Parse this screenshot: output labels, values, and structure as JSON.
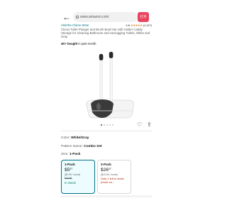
{
  "browser": {
    "back_glyph": "←",
    "url": "www.amazon.com",
    "open_app_label": "打开"
  },
  "product": {
    "store_link": "Visit the Clorox Store",
    "rating_value": "4.6",
    "rating_stars": "★★★★★",
    "rating_count": "(1,117)",
    "title": "Clorox Toilet Plunger and Brush Bowl Set with Holder Caddy Storage for Cleaning Bathroom and Unclogging Toilets, White and Gray",
    "bought_strong": "4K+ bought",
    "bought_rest": " in past month",
    "image_dots_total": 5,
    "image_dot_active": 1
  },
  "options": {
    "color_label": "Color: ",
    "color_value": "White/Gray",
    "pattern_label": "Pattern Name: ",
    "pattern_value": "Combo Set",
    "size_label": "Size: ",
    "size_value": "1-Pack",
    "sizes": [
      {
        "name": "1-Pack",
        "price_whole": "$5",
        "price_frac": "97",
        "unit": "($2.99 / count)",
        "list_price": "$19.99",
        "stock": "In Stock",
        "selected": true
      },
      {
        "name": "2-Pack",
        "price_whole": "$26",
        "price_frac": "07",
        "unit": "($13.04 / count)",
        "stock": "Only 1 left in stock (more on...",
        "selected": false
      }
    ]
  },
  "colors": {
    "link": "#007185",
    "open_app": "#e9445f",
    "star": "#de7921",
    "in_stock": "#067d62",
    "low_stock": "#b12704"
  }
}
